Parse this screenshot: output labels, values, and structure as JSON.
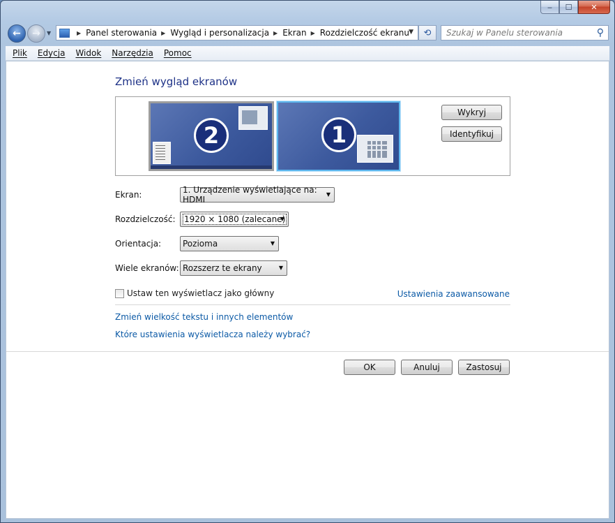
{
  "window": {
    "caption": {
      "minimize": "‒",
      "maximize": "☐",
      "close": "✕"
    }
  },
  "navbar": {
    "breadcrumbs": [
      "Panel sterowania",
      "Wygląd i personalizacja",
      "Ekran",
      "Rozdzielczość ekranu"
    ],
    "search_placeholder": "Szukaj w Panelu sterowania"
  },
  "menu": [
    "Plik",
    "Edycja",
    "Widok",
    "Narzędzia",
    "Pomoc"
  ],
  "main": {
    "title": "Zmień wygląd ekranów",
    "monitors": [
      {
        "number": "2",
        "selected": false
      },
      {
        "number": "1",
        "selected": true
      }
    ],
    "detect_button": "Wykryj",
    "identify_button": "Identyfikuj",
    "fields": {
      "screen": {
        "label": "Ekran:",
        "value": "1. Urządzenie wyświetlające na: HDMI"
      },
      "resolution": {
        "label": "Rozdzielczość:",
        "value": "1920 × 1080 (zalecane)"
      },
      "orientation": {
        "label": "Orientacja:",
        "value": "Pozioma"
      },
      "multiple_displays": {
        "label": "Wiele ekranów:",
        "value": "Rozszerz te ekrany"
      }
    },
    "primary_checkbox": {
      "label": "Ustaw ten wyświetlacz jako główny",
      "checked": false
    },
    "advanced_link": "Ustawienia zaawansowane",
    "link_text_size": "Zmień wielkość tekstu i innych elementów",
    "link_which_settings": "Które ustawienia wyświetlacza należy wybrać?",
    "ok_button": "OK",
    "cancel_button": "Anuluj",
    "apply_button": "Zastosuj"
  }
}
